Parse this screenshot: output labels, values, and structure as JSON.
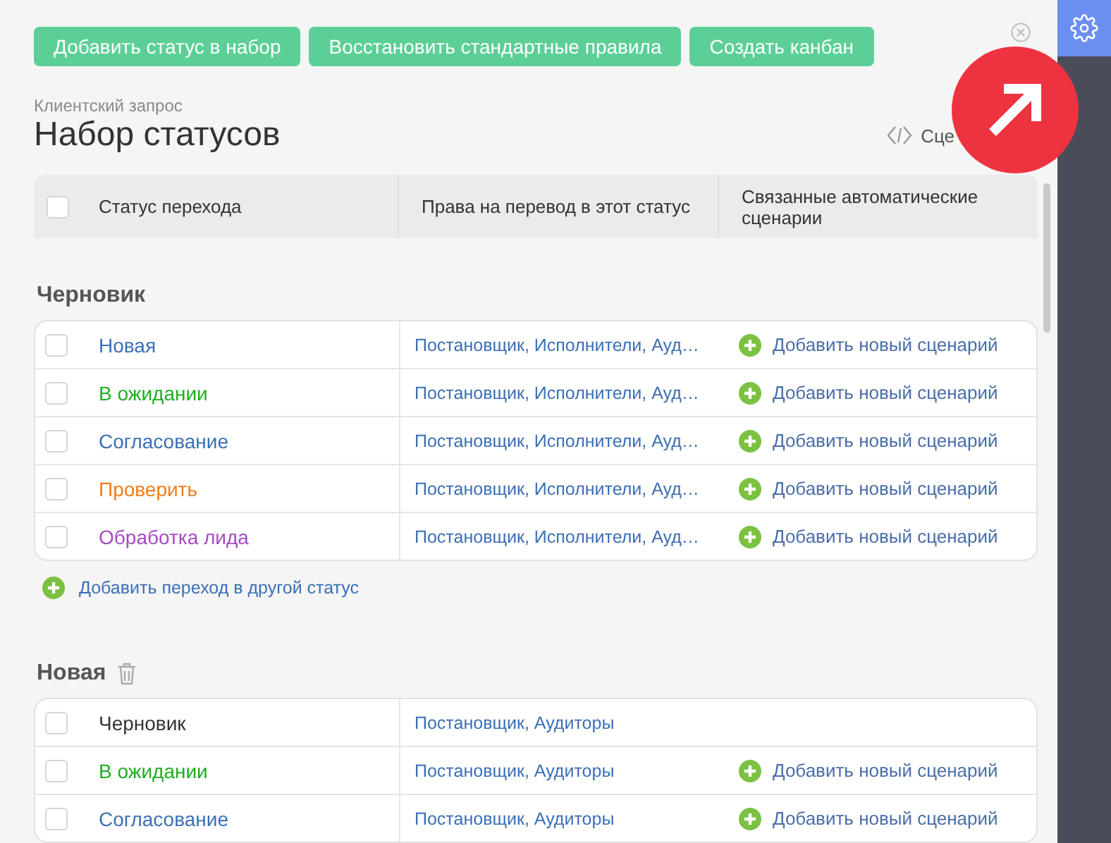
{
  "toolbar": {
    "buttons": [
      "Добавить статус в набор",
      "Восстановить стандартные правила",
      "Создать канбан"
    ]
  },
  "subtitle": "Клиентский запрос",
  "title": "Набор статусов",
  "scenarios_link": "Сце",
  "table": {
    "columns": [
      "Статус перехода",
      "Права на перевод в этот статус",
      "Связанные автоматические сценарии"
    ],
    "header_checked": false
  },
  "groups": [
    {
      "name": "Черновик",
      "deletable": false,
      "rows": [
        {
          "status": "Новая",
          "color": "#3b6fb6",
          "checked": false,
          "rights": "Постановщик, Исполнители, Ауд…",
          "scenario": "Добавить новый сценарий"
        },
        {
          "status": "В ожидании",
          "color": "#1fae1f",
          "checked": false,
          "rights": "Постановщик, Исполнители, Ауд…",
          "scenario": "Добавить новый сценарий"
        },
        {
          "status": "Согласование",
          "color": "#3b6fb6",
          "checked": false,
          "rights": "Постановщик, Исполнители, Ауд…",
          "scenario": "Добавить новый сценарий"
        },
        {
          "status": "Проверить",
          "color": "#f57c14",
          "checked": false,
          "rights": "Постановщик, Исполнители, Ауд…",
          "scenario": "Добавить новый сценарий"
        },
        {
          "status": "Обработка лида",
          "color": "#a64bc2",
          "checked": false,
          "rights": "Постановщик, Исполнители, Ауд…",
          "scenario": "Добавить новый сценарий"
        }
      ],
      "add_transition": "Добавить переход в другой статус"
    },
    {
      "name": "Новая",
      "deletable": true,
      "rows": [
        {
          "status": "Черновик",
          "color": "#333333",
          "checked": false,
          "rights": "Постановщик, Аудиторы"
        },
        {
          "status": "В ожидании",
          "color": "#1fae1f",
          "checked": false,
          "rights": "Постановщик, Аудиторы",
          "scenario": "Добавить новый сценарий"
        },
        {
          "status": "Согласование",
          "color": "#3b6fb6",
          "checked": false,
          "rights": "Постановщик, Аудиторы",
          "scenario": "Добавить новый сценарий"
        }
      ]
    }
  ]
}
